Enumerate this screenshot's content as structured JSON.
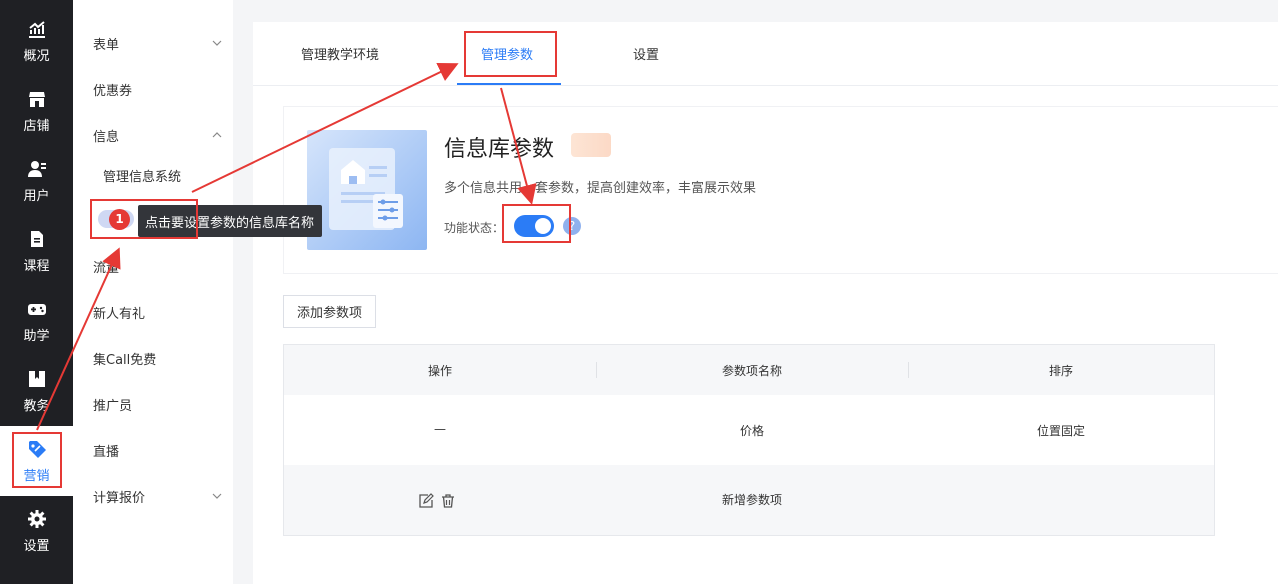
{
  "rail": {
    "items": [
      {
        "label": "概况",
        "icon": "chart-up-icon"
      },
      {
        "label": "店铺",
        "icon": "store-icon"
      },
      {
        "label": "用户",
        "icon": "users-icon"
      },
      {
        "label": "课程",
        "icon": "document-icon"
      },
      {
        "label": "助学",
        "icon": "gamepad-icon"
      },
      {
        "label": "教务",
        "icon": "bookmark-icon"
      },
      {
        "label": "营销",
        "icon": "tag-icon",
        "active": true
      },
      {
        "label": "设置",
        "icon": "gear-icon"
      }
    ],
    "active_color": "#2b7cf6"
  },
  "submenu": {
    "items": [
      {
        "label": "表单",
        "chevron": "down"
      },
      {
        "label": "优惠券"
      },
      {
        "label": "信息",
        "chevron": "up"
      },
      {
        "label": "管理信息系统",
        "child": true
      },
      {
        "label": "流量"
      },
      {
        "label": "新人有礼"
      },
      {
        "label": "集Call免费"
      },
      {
        "label": "推广员"
      },
      {
        "label": "直播"
      },
      {
        "label": "计算报价",
        "chevron": "down"
      }
    ]
  },
  "tabs": [
    {
      "label": "管理教学环境"
    },
    {
      "label": "管理参数",
      "active": true
    },
    {
      "label": "设置"
    }
  ],
  "info": {
    "title": "信息库参数",
    "description": "多个信息共用一套参数，提高创建效率，丰富展示效果",
    "status_label": "功能状态：",
    "status_on": true,
    "help_glyph": "?"
  },
  "add_button": "添加参数项",
  "table": {
    "headers": [
      "操作",
      "参数项名称",
      "排序"
    ],
    "rows": [
      {
        "op": "—",
        "name": "价格",
        "sort": "位置固定"
      },
      {
        "op_icons": [
          "edit-icon",
          "trash-icon"
        ],
        "name": "新增参数项",
        "sort": ""
      }
    ]
  },
  "annotation": {
    "step": "1",
    "tooltip": "点击要设置参数的信息库名称",
    "color": "#e53935"
  }
}
